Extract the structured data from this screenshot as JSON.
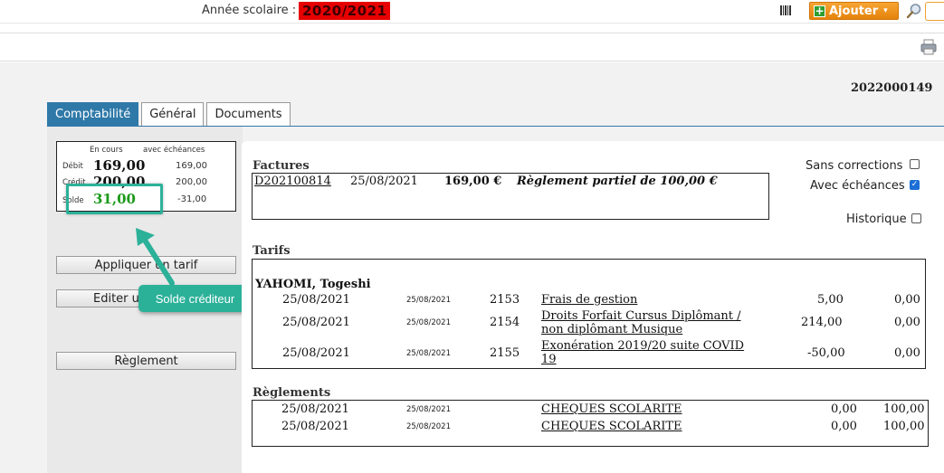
{
  "topbar": {
    "school_year_label": "Année scolaire :",
    "school_year_value": "2020/2021",
    "add_button_label": "Ajouter",
    "add_plus": "+",
    "add_caret": "▾"
  },
  "record": {
    "id": "2022000149"
  },
  "tabs": [
    {
      "label": "Comptabilité",
      "active": true
    },
    {
      "label": "Général",
      "active": false
    },
    {
      "label": "Documents",
      "active": false
    }
  ],
  "summary": {
    "col_en_cours": "En cours",
    "col_avec_echeances": "avec échéances",
    "debit_label": "Débit",
    "debit_en_cours": "169,00",
    "debit_avec": "169,00",
    "credit_label": "Crédit",
    "credit_en_cours": "200,00",
    "credit_avec": "200,00",
    "solde_label": "Solde",
    "solde_en_cours": "31,00",
    "solde_avec": "-31,00"
  },
  "left_buttons": {
    "appliquer_tarif": "Appliquer un tarif",
    "editer": "Editer u",
    "reglement": "Règlement"
  },
  "tooltip": {
    "text": "Solde créditeur"
  },
  "factures": {
    "title": "Factures",
    "row": {
      "number": "D202100814",
      "date": "25/08/2021",
      "amount": "169,00 €",
      "status": "Règlement partiel de 100,00 €"
    }
  },
  "options": {
    "sans_corrections": "Sans corrections",
    "avec_echeances": "Avec échéances",
    "historique": "Historique"
  },
  "tarifs": {
    "title": "Tarifs",
    "person": "YAHOMI, Togeshi",
    "rows": [
      {
        "date": "25/08/2021",
        "small_date": "25/08/2021",
        "code": "2153",
        "label_1": "Frais de gestion",
        "label_2": "",
        "amount": "5,00",
        "paid": "0,00"
      },
      {
        "date": "25/08/2021",
        "small_date": "25/08/2021",
        "code": "2154",
        "label_1": "Droits Forfait Cursus Diplômant /",
        "label_2": "non diplômant Musique",
        "amount": "214,00",
        "paid": "0,00"
      },
      {
        "date": "25/08/2021",
        "small_date": "25/08/2021",
        "code": "2155",
        "label_1": "Exonération 2019/20 suite COVID",
        "label_2": "19",
        "amount": "-50,00",
        "paid": "0,00"
      }
    ]
  },
  "reglements": {
    "title": "Règlements",
    "rows": [
      {
        "date": "25/08/2021",
        "small_date": "25/08/2021",
        "label": "CHEQUES SCOLARITE",
        "amount": "0,00",
        "paid": "100,00"
      },
      {
        "date": "25/08/2021",
        "small_date": "25/08/2021",
        "label": "CHEQUES SCOLARITE",
        "amount": "0,00",
        "paid": "100,00"
      }
    ]
  },
  "colors": {
    "accent": "#2f79a8",
    "highlight": "#2cb199",
    "year_bg": "#e60000",
    "solde_green": "#1a9a1a",
    "add_orange": "#f39a22"
  },
  "icons": [
    "barcode-icon",
    "plus-icon",
    "magnifier-icon",
    "printer-icon",
    "arrow-icon",
    "checkbox-icon"
  ]
}
